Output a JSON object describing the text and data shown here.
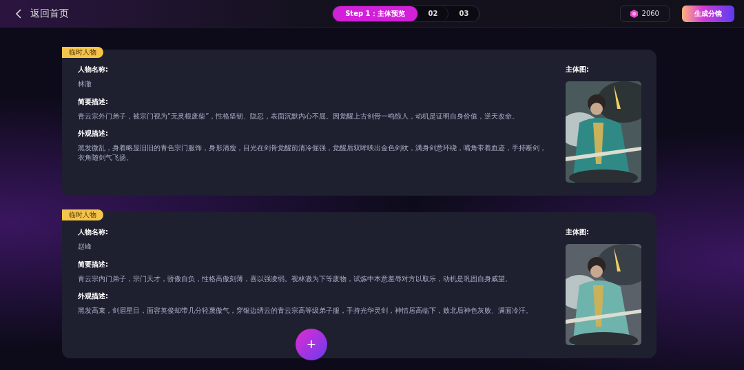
{
  "header": {
    "back_label": "返回首页",
    "steps": [
      {
        "label": "Step 1：主体预览",
        "selected": true
      },
      {
        "label": "02",
        "selected": false
      },
      {
        "label": "03",
        "selected": false
      }
    ],
    "credits": "2060",
    "generate_button": "生成分镜"
  },
  "characters": [
    {
      "tag": "临时人物",
      "name_label": "人物名称:",
      "name": "林澈",
      "brief_label": "简要描述:",
      "brief": "青云宗外门弟子，被宗门视为“无灵根废柴”，性格坚韧、隐忍，表面沉默内心不屈。因觉醒上古剑骨一鸣惊人，动机是证明自身价值，逆天改命。",
      "look_label": "外观描述:",
      "look": "黑发微乱，身着略显旧旧的青色宗门服饰，身形清瘦，目光在剑骨觉醒前清冷倔强，觉醒后双眸映出金色剑纹，满身剑意环绕，嘴角带着血迹，手持断剑，衣角随剑气飞扬。",
      "image_label": "主体图:"
    },
    {
      "tag": "临时人物",
      "name_label": "人物名称:",
      "name": "赵峰",
      "brief_label": "简要描述:",
      "brief": "青云宗内门弟子，宗门天才，骄傲自负，性格高傲刻薄，喜以强凌弱。视林澈为下等废物，试炼中本意羞辱对方以取乐，动机是巩固自身威望。",
      "look_label": "外观描述:",
      "look": "黑发高束，剑眉星目，面容英俊却带几分轻蔑傲气，穿银边绣云的青云宗高等级弟子服，手持光华灵剑，神情居高临下，败北后神色灰败、满面冷汗。",
      "image_label": "主体图:"
    }
  ],
  "add_button": "+"
}
